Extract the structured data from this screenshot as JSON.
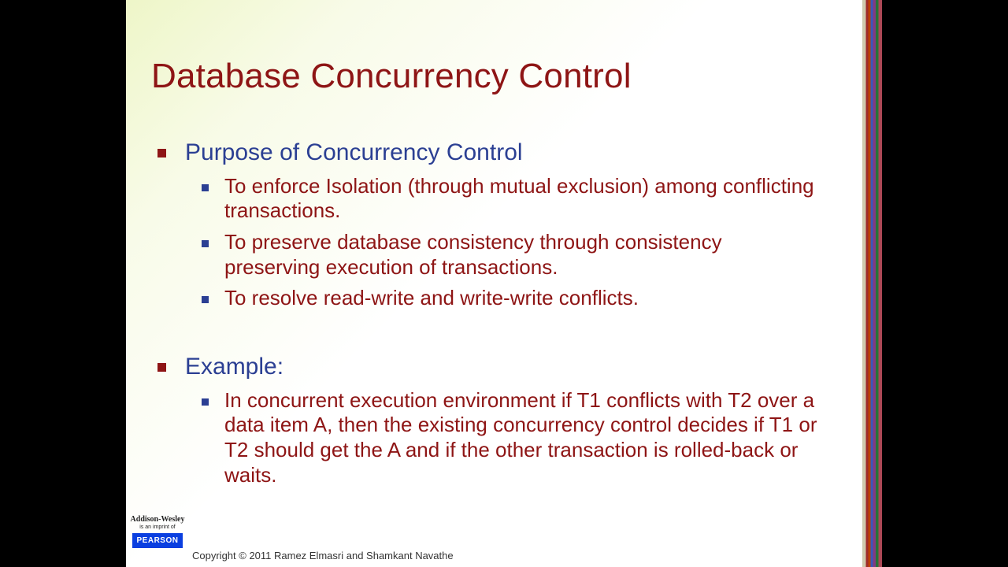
{
  "slide": {
    "title": "Database Concurrency Control",
    "sections": [
      {
        "heading": "Purpose of Concurrency Control",
        "items": [
          "To enforce Isolation (through mutual exclusion) among conflicting transactions.",
          "To preserve database consistency through consistency preserving execution of transactions.",
          "To resolve read-write and write-write conflicts."
        ]
      },
      {
        "heading": "Example:",
        "items": [
          "In concurrent execution environment if T1 conflicts with T2 over a data item A, then the existing concurrency control decides if T1 or T2 should get the A and if the other transaction is rolled-back or waits."
        ]
      }
    ]
  },
  "brand": {
    "addison_wesley": "Addison-Wesley",
    "imprint": "is an imprint of",
    "pearson": "PEARSON"
  },
  "copyright": "Copyright © 2011 Ramez Elmasri and Shamkant Navathe"
}
